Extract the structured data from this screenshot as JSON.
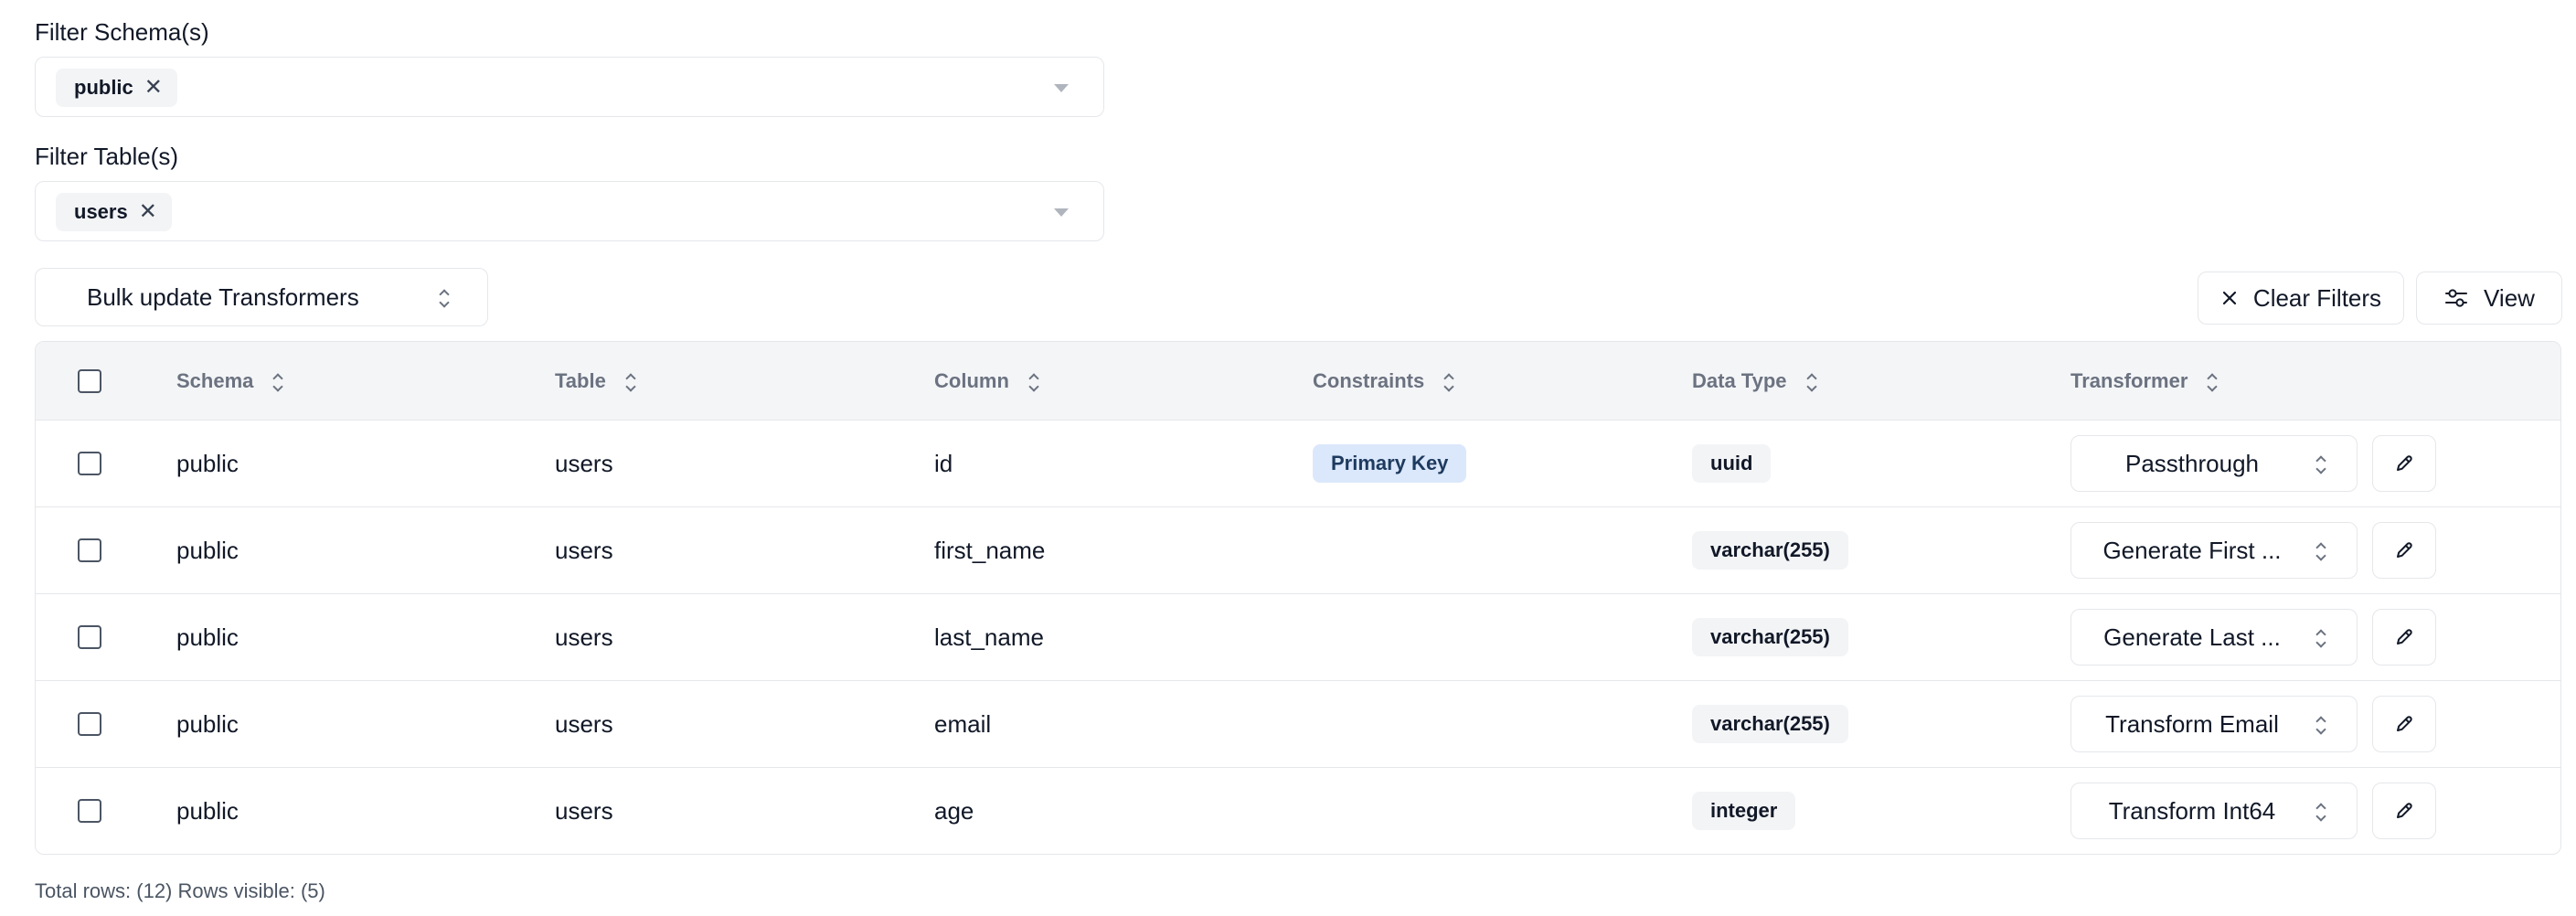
{
  "filters": {
    "schema": {
      "label": "Filter Schema(s)",
      "chip": "public"
    },
    "table": {
      "label": "Filter Table(s)",
      "chip": "users"
    }
  },
  "toolbar": {
    "bulk_label": "Bulk update Transformers",
    "clear_label": "Clear Filters",
    "view_label": "View"
  },
  "table": {
    "headers": {
      "schema": "Schema",
      "table": "Table",
      "column": "Column",
      "constraints": "Constraints",
      "data_type": "Data Type",
      "transformer": "Transformer"
    },
    "rows": [
      {
        "schema": "public",
        "table": "users",
        "column": "id",
        "constraint": "Primary Key",
        "data_type": "uuid",
        "transformer": "Passthrough"
      },
      {
        "schema": "public",
        "table": "users",
        "column": "first_name",
        "constraint": "",
        "data_type": "varchar(255)",
        "transformer": "Generate First ..."
      },
      {
        "schema": "public",
        "table": "users",
        "column": "last_name",
        "constraint": "",
        "data_type": "varchar(255)",
        "transformer": "Generate Last ..."
      },
      {
        "schema": "public",
        "table": "users",
        "column": "email",
        "constraint": "",
        "data_type": "varchar(255)",
        "transformer": "Transform Email"
      },
      {
        "schema": "public",
        "table": "users",
        "column": "age",
        "constraint": "",
        "data_type": "integer",
        "transformer": "Transform Int64"
      }
    ]
  },
  "footer": {
    "text": "Total rows: (12) Rows visible: (5)"
  },
  "icons": {
    "chip_remove": "x-icon",
    "dropdown": "chevron-down-icon",
    "sort": "chevron-up-down-icon",
    "clear": "x-icon",
    "view": "sliders-icon",
    "edit": "pencil-icon"
  },
  "colors": {
    "primary_key_badge": "#dbe8fb",
    "type_badge": "#f3f4f6",
    "header_bg": "#f4f5f7",
    "border": "#e5e7eb"
  }
}
